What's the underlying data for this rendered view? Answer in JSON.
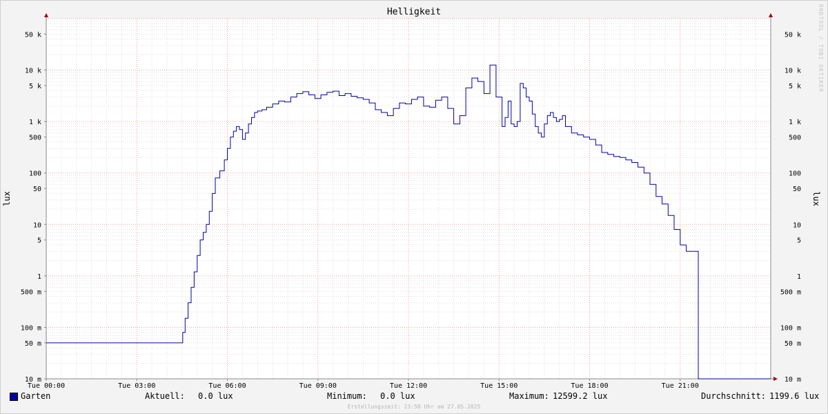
{
  "chart_data": {
    "type": "line",
    "title": "Helligkeit",
    "ylabel": "lux",
    "yscale": "log",
    "ylim": [
      0.01,
      100000
    ],
    "xlim_hours": [
      0,
      24
    ],
    "grid": true,
    "x_ticks": [
      "Tue 00:00",
      "Tue 03:00",
      "Tue 06:00",
      "Tue 09:00",
      "Tue 12:00",
      "Tue 15:00",
      "Tue 18:00",
      "Tue 21:00"
    ],
    "y_ticks": [
      {
        "value": 0.01,
        "label": "10 m"
      },
      {
        "value": 0.05,
        "label": "50 m"
      },
      {
        "value": 0.1,
        "label": "100 m"
      },
      {
        "value": 0.5,
        "label": "500 m"
      },
      {
        "value": 1,
        "label": "1"
      },
      {
        "value": 5,
        "label": "5"
      },
      {
        "value": 10,
        "label": "10"
      },
      {
        "value": 50,
        "label": "50"
      },
      {
        "value": 100,
        "label": "100"
      },
      {
        "value": 500,
        "label": "500"
      },
      {
        "value": 1000,
        "label": "1 k"
      },
      {
        "value": 5000,
        "label": "5 k"
      },
      {
        "value": 10000,
        "label": "10 k"
      },
      {
        "value": 50000,
        "label": "50 k"
      }
    ],
    "series": [
      {
        "name": "Garten",
        "color": "#0000a6",
        "x_hours": [
          0,
          4.5,
          4.52,
          4.6,
          4.7,
          4.8,
          4.9,
          5.0,
          5.1,
          5.2,
          5.3,
          5.4,
          5.5,
          5.6,
          5.75,
          5.9,
          6.0,
          6.1,
          6.2,
          6.3,
          6.4,
          6.5,
          6.6,
          6.7,
          6.8,
          6.9,
          7.0,
          7.15,
          7.3,
          7.5,
          7.7,
          7.9,
          8.1,
          8.3,
          8.5,
          8.7,
          8.9,
          9.1,
          9.3,
          9.5,
          9.7,
          9.9,
          10.1,
          10.3,
          10.5,
          10.7,
          10.9,
          11.1,
          11.3,
          11.5,
          11.7,
          11.9,
          12.1,
          12.3,
          12.5,
          12.7,
          12.9,
          13.1,
          13.3,
          13.5,
          13.7,
          13.9,
          14.1,
          14.3,
          14.5,
          14.7,
          14.9,
          15.1,
          15.2,
          15.3,
          15.4,
          15.5,
          15.6,
          15.7,
          15.8,
          15.9,
          16.0,
          16.1,
          16.2,
          16.3,
          16.4,
          16.5,
          16.6,
          16.7,
          16.8,
          16.9,
          17.0,
          17.1,
          17.2,
          17.4,
          17.6,
          17.8,
          18.0,
          18.2,
          18.4,
          18.6,
          18.8,
          19.0,
          19.2,
          19.4,
          19.6,
          19.8,
          20.0,
          20.2,
          20.4,
          20.6,
          20.8,
          21.0,
          21.2,
          21.4,
          21.6,
          21.8,
          21.9,
          22.0,
          22.05,
          22.1,
          22.2,
          24.0
        ],
        "values": [
          0.05,
          0.05,
          0.08,
          0.15,
          0.3,
          0.6,
          1.2,
          2.5,
          5,
          7,
          10,
          18,
          40,
          80,
          110,
          180,
          300,
          500,
          650,
          800,
          700,
          450,
          600,
          900,
          1200,
          1500,
          1600,
          1700,
          1900,
          2200,
          2500,
          2400,
          3000,
          3500,
          3800,
          3300,
          2800,
          3300,
          3700,
          3900,
          3200,
          3500,
          3100,
          2900,
          2700,
          2300,
          1700,
          1500,
          1300,
          1800,
          2300,
          2200,
          2700,
          3000,
          2000,
          1900,
          2600,
          3000,
          1800,
          900,
          1300,
          4500,
          7000,
          6000,
          3500,
          12500,
          3000,
          800,
          1200,
          2500,
          900,
          800,
          1000,
          5500,
          4500,
          3000,
          2500,
          1400,
          800,
          600,
          500,
          900,
          1300,
          1500,
          1200,
          1000,
          1100,
          1300,
          800,
          600,
          550,
          500,
          450,
          350,
          250,
          230,
          210,
          200,
          180,
          160,
          130,
          100,
          60,
          35,
          25,
          15,
          8,
          4,
          3,
          3,
          0.01,
          0.01,
          0.01,
          0.01,
          0.01,
          0.01,
          0.01,
          0.01
        ]
      }
    ]
  },
  "watermark": "RRDTOOL / TOBI OETIKER",
  "legend": {
    "series_name": "Garten",
    "current_label": "Aktuell:",
    "current_value": "0.0 lux",
    "min_label": "Minimum:",
    "min_value": "0.0 lux",
    "max_label": "Maximum:",
    "max_value": "12599.2 lux",
    "avg_label": "Durchschnitt:",
    "avg_value": "1199.6 lux"
  },
  "footer": "Erstellungszeit: 23:58 Uhr am 27.05.2025"
}
